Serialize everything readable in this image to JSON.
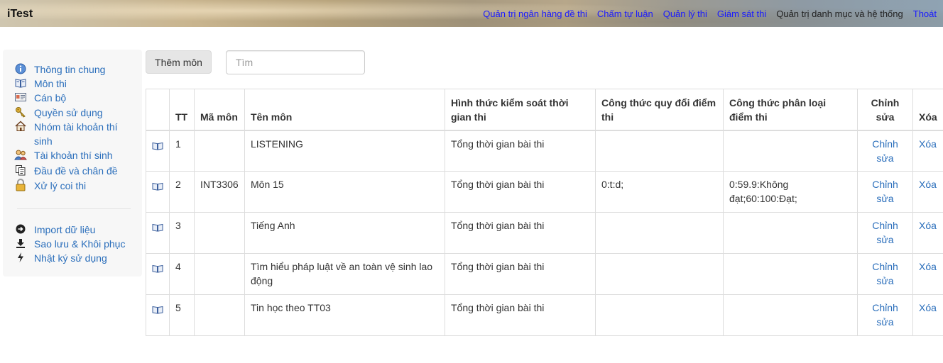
{
  "header": {
    "brand": "iTest",
    "nav": [
      {
        "label": "Quản trị ngân hàng đề thi",
        "name": "nav-question-bank"
      },
      {
        "label": "Chấm tự luận",
        "name": "nav-essay-grading"
      },
      {
        "label": "Quản lý thi",
        "name": "nav-exam-management"
      },
      {
        "label": "Giám sát thi",
        "name": "nav-exam-monitoring"
      },
      {
        "label": "Quản trị danh mục và hệ thống",
        "name": "nav-catalog-system"
      },
      {
        "label": "Thoát",
        "name": "nav-logout"
      }
    ]
  },
  "sidebar": {
    "items": [
      {
        "label": "Thông tin chung",
        "icon": "info-icon"
      },
      {
        "label": "Môn thi",
        "icon": "book-icon"
      },
      {
        "label": "Cán bộ",
        "icon": "id-card-icon"
      },
      {
        "label": "Quyền sử dụng",
        "icon": "keys-icon"
      },
      {
        "label": "Nhóm tài khoản thí sinh",
        "icon": "house-icon"
      },
      {
        "label": "Tài khoản thí sinh",
        "icon": "users-icon"
      },
      {
        "label": "Đầu đề và chân đề",
        "icon": "documents-icon"
      },
      {
        "label": "Xử lý coi thi",
        "icon": "lock-icon"
      }
    ],
    "tools": [
      {
        "label": "Import dữ liệu",
        "icon": "arrow-circle-icon"
      },
      {
        "label": "Sao lưu & Khôi phục",
        "icon": "download-icon"
      },
      {
        "label": "Nhật ký sử dụng",
        "icon": "flash-icon"
      }
    ]
  },
  "toolbar": {
    "add_label": "Thêm môn",
    "search_placeholder": "Tìm"
  },
  "table": {
    "headers": [
      "",
      "TT",
      "Mã môn",
      "Tên môn",
      "Hình thức kiểm soát thời gian thi",
      "Công thức quy đổi điểm thi",
      "Công thức phân loại điểm thi",
      "Chỉnh sửa",
      "Xóa"
    ],
    "rows": [
      {
        "tt": "1",
        "code": "",
        "name": "LISTENING",
        "time_control": "Tổng thời gian bài thi",
        "conversion": "",
        "classification": "",
        "edit": "Chỉnh sửa",
        "delete": "Xóa"
      },
      {
        "tt": "2",
        "code": "INT3306",
        "name": "Môn 15",
        "time_control": "Tổng thời gian bài thi",
        "conversion": "0:t:d;",
        "classification": "0:59.9:Không đạt;60:100:Đạt;",
        "edit": "Chỉnh sửa",
        "delete": "Xóa"
      },
      {
        "tt": "3",
        "code": "",
        "name": "Tiếng Anh",
        "time_control": "Tổng thời gian bài thi",
        "conversion": "",
        "classification": "",
        "edit": "Chỉnh sửa",
        "delete": "Xóa"
      },
      {
        "tt": "4",
        "code": "",
        "name": "Tìm hiểu pháp luật về an toàn vệ sinh lao động",
        "time_control": "Tổng thời gian bài thi",
        "conversion": "",
        "classification": "",
        "edit": "Chỉnh sửa",
        "delete": "Xóa"
      },
      {
        "tt": "5",
        "code": "",
        "name": "Tin học theo TT03",
        "time_control": "Tổng thời gian bài thi",
        "conversion": "",
        "classification": "",
        "edit": "Chỉnh sửa",
        "delete": "Xóa"
      }
    ]
  },
  "colors": {
    "link": "#2a6ebb",
    "nav_link": "#1a1aff",
    "border": "#dddddd"
  }
}
